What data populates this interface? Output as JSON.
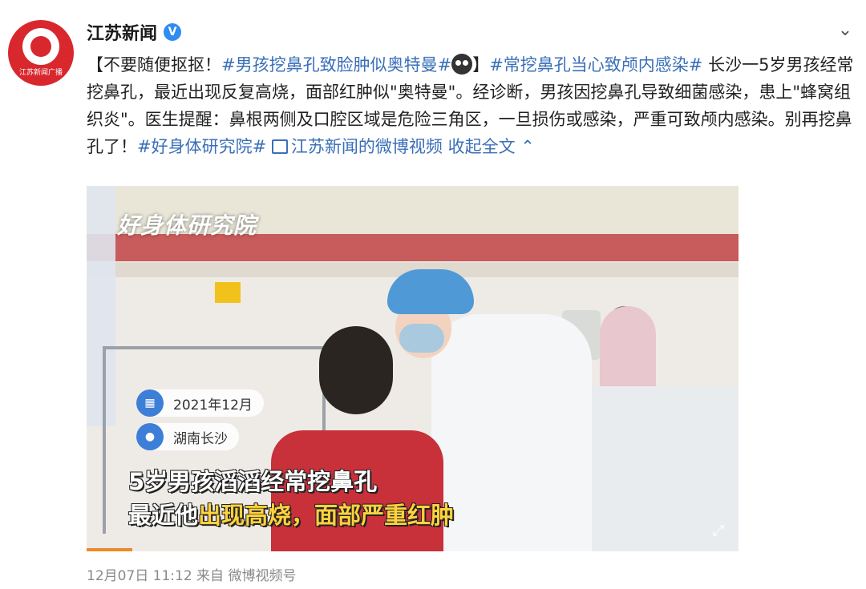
{
  "account": {
    "name": "江苏新闻",
    "avatar_text": "江苏新闻广播",
    "verified_mark": "V"
  },
  "menu_icon": "chevron-down-icon",
  "post": {
    "segments": [
      {
        "text": "【不要随便抠抠！",
        "type": "text"
      },
      {
        "text": "#男孩挖鼻孔致脸肿似奥特曼#",
        "type": "tag"
      },
      {
        "text": "",
        "type": "emoji"
      },
      {
        "text": "】",
        "type": "text"
      },
      {
        "text": "#常挖鼻孔当心致颅内感染#",
        "type": "tag"
      },
      {
        "text": " 长沙一5岁男孩经常挖鼻孔，最近出现反复高烧，面部红肿似\"奥特曼\"。经诊断，男孩因挖鼻孔导致细菌感染，患上\"蜂窝组织炎\"。医生提醒：鼻根两侧及口腔区域是危险三角区，一旦损伤或感染，严重可致颅内感染。别再挖鼻孔了！",
        "type": "text"
      },
      {
        "text": "#好身体研究院#",
        "type": "tag"
      },
      {
        "text": " ",
        "type": "text"
      },
      {
        "text": "江苏新闻的微博视频",
        "type": "video-link"
      },
      {
        "text": " 收起全文",
        "type": "collapse"
      }
    ]
  },
  "video": {
    "brand": "好身体研究院",
    "date": "2021年12月",
    "location": "湖南长沙",
    "caption_line1": "5岁男孩滔滔经常挖鼻孔",
    "caption_line2_prefix": "最近他",
    "caption_line2_highlight": "出现高烧，面部严重红肿",
    "progress": 0.07
  },
  "meta": "12月07日 11:12  来自 微博视频号",
  "colors": {
    "link": "#3a6fb8",
    "brand_red": "#d9272e",
    "verified": "#2f8cf0",
    "caption_highlight": "#ffd23d"
  }
}
